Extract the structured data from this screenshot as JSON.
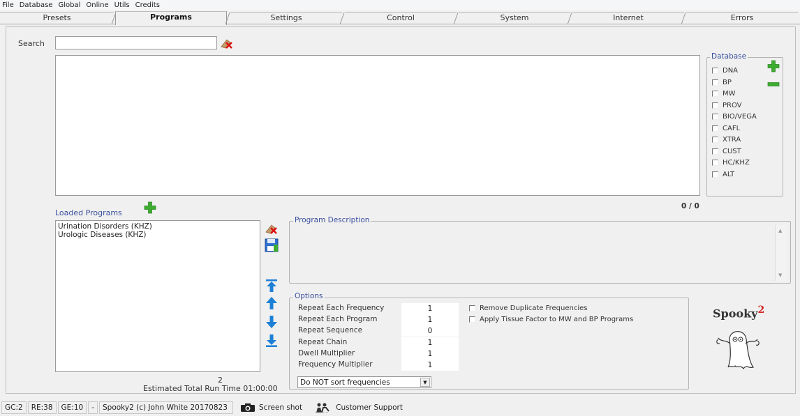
{
  "menu": [
    "File",
    "Database",
    "Global",
    "Online",
    "Utils",
    "Credits"
  ],
  "tabs": [
    "Presets",
    "Programs",
    "Settings",
    "Control",
    "System",
    "Internet",
    "Errors"
  ],
  "active_tab": "Programs",
  "search": {
    "label": "Search",
    "value": "",
    "clear_icon": "eraser-icon"
  },
  "database": {
    "legend": "Database",
    "items": [
      "DNA",
      "BP",
      "MW",
      "PROV",
      "BIO/VEGA",
      "CAFL",
      "XTRA",
      "CUST",
      "HC/KHZ",
      "ALT"
    ],
    "count": "0 / 0"
  },
  "loaded_programs": {
    "label": "Loaded Programs",
    "items": [
      "Urination Disorders (KHZ)",
      "Urologic Diseases (KHZ)"
    ],
    "count": "2",
    "run_time": "Estimated Total Run Time 01:00:00"
  },
  "program_description": {
    "legend": "Program Description"
  },
  "options": {
    "legend": "Options",
    "rows": [
      {
        "label": "Repeat Each Frequency",
        "value": "1"
      },
      {
        "label": "Repeat Each Program",
        "value": "1"
      },
      {
        "label": "Repeat Sequence",
        "value": "0"
      },
      {
        "label": "Repeat Chain",
        "value": "1"
      },
      {
        "label": "Dwell Multiplier",
        "value": "1"
      },
      {
        "label": "Frequency Multiplier",
        "value": "1"
      }
    ],
    "checks": [
      "Remove Duplicate Frequencies",
      "Apply Tissue Factor to MW and BP Programs"
    ],
    "sort_select": "Do NOT sort frequencies"
  },
  "logo": {
    "text": "Spooky",
    "superscript": "2"
  },
  "statusbar": {
    "gc": "GC:2",
    "re": "RE:38",
    "ge": "GE:10",
    "dash": "-",
    "copyright": "Spooky2 (c) John White 20170823",
    "screenshot": "Screen shot",
    "support": "Customer Support"
  },
  "colors": {
    "accent_green": "#3cae2f",
    "arrow_blue": "#1e7fd6",
    "legend_blue": "#3a4f9e",
    "logo_red": "#d42424"
  }
}
